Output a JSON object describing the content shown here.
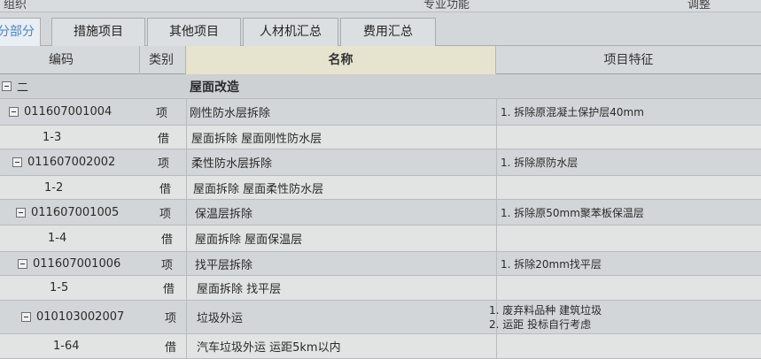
{
  "top_strip": {
    "left": "组织",
    "center": "专业功能",
    "right": "调整"
  },
  "tabs": [
    {
      "label": "分部分项",
      "active": true
    },
    {
      "label": "措施项目",
      "active": false
    },
    {
      "label": "其他项目",
      "active": false
    },
    {
      "label": "人材机汇总",
      "active": false
    },
    {
      "label": "费用汇总",
      "active": false
    }
  ],
  "columns": {
    "code": "编码",
    "type": "类别",
    "name": "名称",
    "feature": "项目特征"
  },
  "section": {
    "code": "二",
    "name": "屋面改造"
  },
  "rows": [
    {
      "kind": "item",
      "code": "011607001004",
      "type": "项",
      "name": "刚性防水层拆除",
      "feature": [
        "1. 拆除原混凝土保护层40mm"
      ]
    },
    {
      "kind": "sub",
      "code": "1-3",
      "type": "借",
      "name": "屋面拆除 屋面刚性防水层",
      "feature": []
    },
    {
      "kind": "item",
      "code": "011607002002",
      "type": "项",
      "name": "柔性防水层拆除",
      "feature": [
        "1. 拆除原防水层"
      ]
    },
    {
      "kind": "sub",
      "code": "1-2",
      "type": "借",
      "name": "屋面拆除 屋面柔性防水层",
      "feature": []
    },
    {
      "kind": "item",
      "code": "011607001005",
      "type": "项",
      "name": "保温层拆除",
      "feature": [
        "1. 拆除原50mm聚苯板保温层"
      ]
    },
    {
      "kind": "sub",
      "code": "1-4",
      "type": "借",
      "name": "屋面拆除 屋面保温层",
      "feature": []
    },
    {
      "kind": "item",
      "code": "011607001006",
      "type": "项",
      "name": "找平层拆除",
      "feature": [
        "1. 拆除20mm找平层"
      ]
    },
    {
      "kind": "sub",
      "code": "1-5",
      "type": "借",
      "name": "屋面拆除 找平层",
      "feature": []
    },
    {
      "kind": "item",
      "code": "010103002007",
      "type": "项",
      "name": "垃圾外运",
      "feature": [
        "1. 废弃料品种 建筑垃圾",
        "2. 运距 投标自行考虑"
      ]
    },
    {
      "kind": "sub",
      "code": "1-64",
      "type": "借",
      "name": "汽车垃圾外运 运距5km以内",
      "feature": []
    }
  ],
  "colors": {
    "active_tab_text": "#4b86c4",
    "name_header_bg": "#e6e3cf"
  }
}
